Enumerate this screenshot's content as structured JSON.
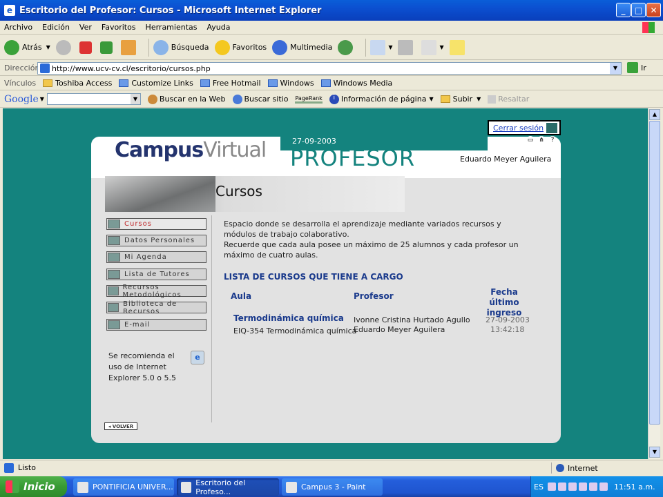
{
  "window": {
    "title": "Escritorio del Profesor: Cursos - Microsoft Internet Explorer"
  },
  "menu": [
    "Archivo",
    "Edición",
    "Ver",
    "Favoritos",
    "Herramientas",
    "Ayuda"
  ],
  "toolbar": {
    "back": "Atrás",
    "search": "Búsqueda",
    "favorites": "Favoritos",
    "media": "Multimedia"
  },
  "address": {
    "label": "Dirección",
    "url": "http://www.ucv-cv.cl/escritorio/cursos.php",
    "go": "Ir"
  },
  "links": {
    "label": "Vínculos",
    "items": [
      "Toshiba Access",
      "Customize Links",
      "Free Hotmail",
      "Windows",
      "Windows Media"
    ]
  },
  "google": {
    "logo": "Google",
    "search_web": "Buscar en la Web",
    "search_site": "Buscar sitio",
    "pagerank": "PageRank",
    "page_info": "Información de página",
    "up": "Subir",
    "highlight": "Resaltar"
  },
  "page": {
    "logo_bold": "Campus",
    "logo_light": "Virtual",
    "date": "27-09-2003",
    "role": "PROFESOR",
    "user": "Eduardo Meyer Aguilera",
    "logout": "Cerrar sesión",
    "banner_title": "Cursos",
    "nav": [
      "Cursos",
      "Datos Personales",
      "Mi Agenda",
      "Lista de Tutores",
      "Recursos Metodológicos",
      "Biblioteca de Recursos",
      "E-mail"
    ],
    "recommend": "Se recomienda el uso de Internet Explorer 5.0 o 5.5",
    "back": "VOLVER",
    "intro_1": "Espacio donde se desarrolla el aprendizaje mediante variados recursos y módulos de trabajo colaborativo.",
    "intro_2": "Recuerde que cada aula posee un máximo de 25 alumnos y cada profesor un máximo de cuatro aulas.",
    "list_title": "LISTA DE CURSOS QUE TIENE A CARGO",
    "headers": {
      "aula": "Aula",
      "profesor": "Profesor",
      "fecha": "Fecha último ingreso"
    },
    "course": {
      "name": "Termodinámica química",
      "code": "EIQ-354 Termodinámica química",
      "teacher_1": "Ivonne Cristina Hurtado Agullo",
      "teacher_2": "Eduardo Meyer Aguilera",
      "date": "27-09-2003",
      "time": "13:42:18"
    }
  },
  "status": {
    "text": "Listo",
    "zone": "Internet"
  },
  "taskbar": {
    "start": "Inicio",
    "tasks": [
      "PONTIFICIA UNIVER...",
      "Escritorio del Profeso...",
      "Campus 3 - Paint"
    ],
    "lang": "ES",
    "clock": "11:51 a.m."
  }
}
